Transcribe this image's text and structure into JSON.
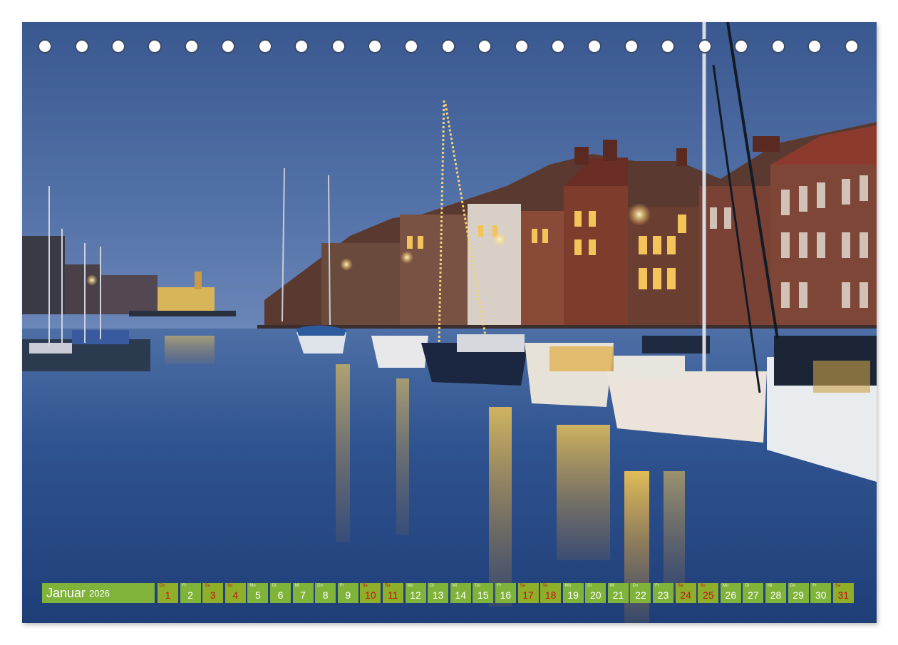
{
  "calendar": {
    "month": "Januar",
    "year": "2026",
    "days": [
      {
        "wd": "Do",
        "num": "1",
        "weekend": true
      },
      {
        "wd": "Fr",
        "num": "2",
        "weekend": false
      },
      {
        "wd": "Sa",
        "num": "3",
        "weekend": true
      },
      {
        "wd": "So",
        "num": "4",
        "weekend": true
      },
      {
        "wd": "Mo",
        "num": "5",
        "weekend": false
      },
      {
        "wd": "Di",
        "num": "6",
        "weekend": false
      },
      {
        "wd": "Mi",
        "num": "7",
        "weekend": false
      },
      {
        "wd": "Do",
        "num": "8",
        "weekend": false
      },
      {
        "wd": "Fr",
        "num": "9",
        "weekend": false
      },
      {
        "wd": "Sa",
        "num": "10",
        "weekend": true
      },
      {
        "wd": "So",
        "num": "11",
        "weekend": true
      },
      {
        "wd": "Mo",
        "num": "12",
        "weekend": false
      },
      {
        "wd": "Di",
        "num": "13",
        "weekend": false
      },
      {
        "wd": "Mi",
        "num": "14",
        "weekend": false
      },
      {
        "wd": "Do",
        "num": "15",
        "weekend": false
      },
      {
        "wd": "Fr",
        "num": "16",
        "weekend": false
      },
      {
        "wd": "Sa",
        "num": "17",
        "weekend": true
      },
      {
        "wd": "So",
        "num": "18",
        "weekend": true
      },
      {
        "wd": "Mo",
        "num": "19",
        "weekend": false
      },
      {
        "wd": "Di",
        "num": "20",
        "weekend": false
      },
      {
        "wd": "Mi",
        "num": "21",
        "weekend": false
      },
      {
        "wd": "Do",
        "num": "22",
        "weekend": false
      },
      {
        "wd": "Fr",
        "num": "23",
        "weekend": false
      },
      {
        "wd": "Sa",
        "num": "24",
        "weekend": true
      },
      {
        "wd": "So",
        "num": "25",
        "weekend": true
      },
      {
        "wd": "Mo",
        "num": "26",
        "weekend": false
      },
      {
        "wd": "Di",
        "num": "27",
        "weekend": false
      },
      {
        "wd": "Mi",
        "num": "28",
        "weekend": false
      },
      {
        "wd": "Do",
        "num": "29",
        "weekend": false
      },
      {
        "wd": "Fr",
        "num": "30",
        "weekend": false
      },
      {
        "wd": "Sa",
        "num": "31",
        "weekend": true
      }
    ]
  },
  "colors": {
    "bar_green": "#7fb33a",
    "weekend_red": "#c0141b",
    "sky_top": "#3c5a8c",
    "water": "#2d4f86",
    "light_gold": "#f5b73a"
  }
}
